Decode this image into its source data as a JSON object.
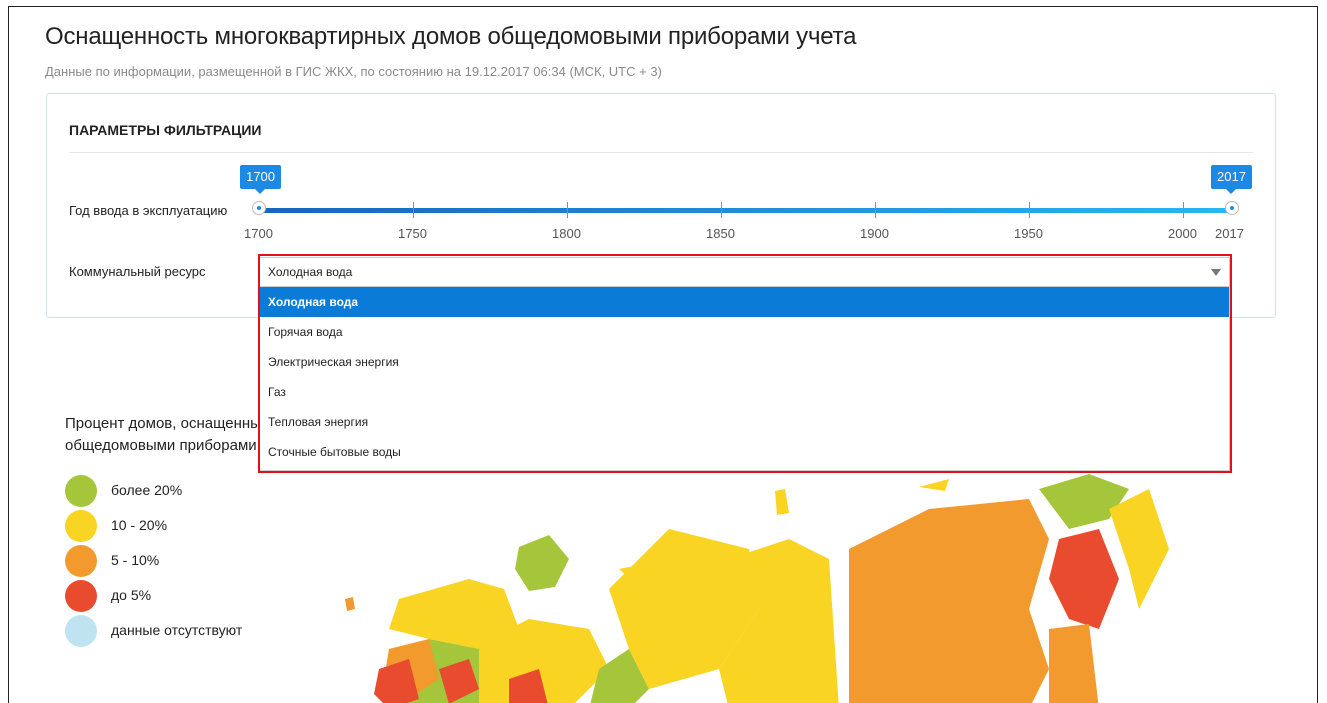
{
  "header": {
    "title": "Оснащенность многоквартирных домов общедомовыми приборами учета",
    "subtitle": "Данные по информации, размещенной в ГИС ЖКХ, по состоянию на 19.12.2017 06:34 (МСК, UTC + 3)"
  },
  "filters": {
    "heading": "ПАРАМЕТРЫ ФИЛЬТРАЦИИ",
    "year_label": "Год ввода в эксплуатацию",
    "year_min": "1700",
    "year_max": "2017",
    "year_ticks": [
      "1700",
      "1750",
      "1800",
      "1850",
      "1900",
      "1950",
      "2000",
      "2017"
    ],
    "resource_label": "Коммунальный ресурс",
    "resource_selected": "Холодная вода",
    "resource_options": [
      "Холодная вода",
      "Горячая вода",
      "Электрическая энергия",
      "Газ",
      "Тепловая энергия",
      "Сточные бытовые воды"
    ]
  },
  "legend": {
    "title_line1": "Процент домов, оснащенны",
    "title_line2": "общедомовыми приборами",
    "items": [
      {
        "label": "более 20%",
        "color": "#a5c63b"
      },
      {
        "label": "10 - 20%",
        "color": "#f9d423"
      },
      {
        "label": "5 - 10%",
        "color": "#f39a2e"
      },
      {
        "label": "до 5%",
        "color": "#e94b2f"
      },
      {
        "label": "данные отсутствуют",
        "color": "#bfe3f0"
      }
    ]
  },
  "colors": {
    "accent": "#1e88e5",
    "selected_option": "#0a7bd6",
    "highlight_border": "#e0101c"
  }
}
